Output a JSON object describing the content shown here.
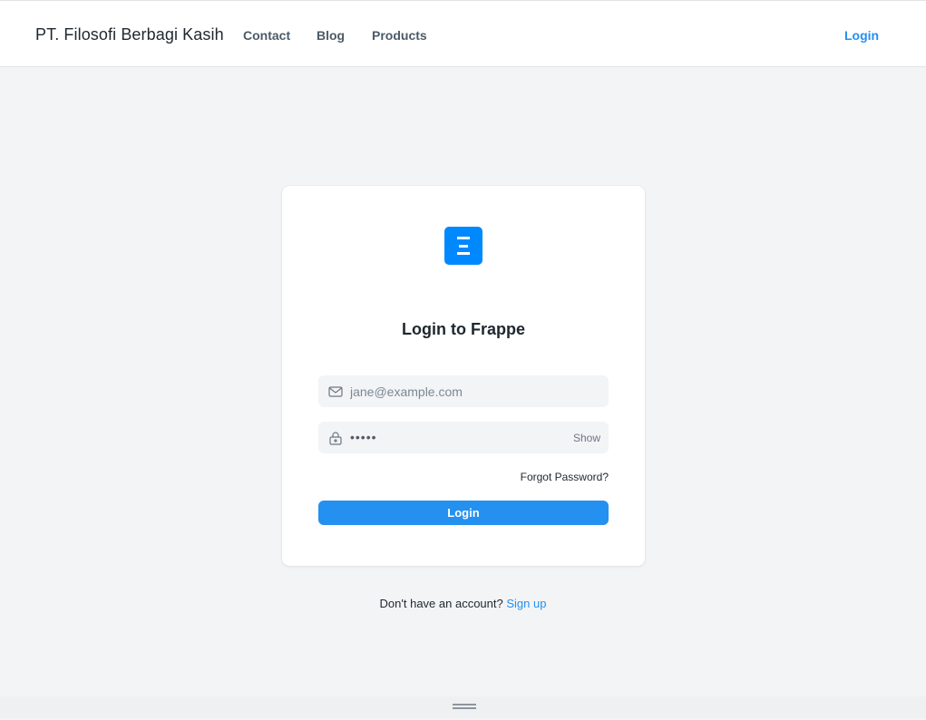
{
  "navbar": {
    "brand": "PT. Filosofi Berbagi Kasih",
    "links": [
      "Contact",
      "Blog",
      "Products"
    ],
    "login": "Login"
  },
  "card": {
    "logo_icon": "frappe-logo-icon",
    "title": "Login to Frappe",
    "email": {
      "icon": "mail-icon",
      "placeholder": "jane@example.com",
      "value": ""
    },
    "password": {
      "icon": "lock-icon",
      "value": "•••••",
      "show_label": "Show"
    },
    "forgot": "Forgot Password?",
    "submit": "Login"
  },
  "signup": {
    "prompt": "Don't have an account?",
    "link": "Sign up"
  },
  "colors": {
    "accent": "#2490ef",
    "logo": "#0089ff",
    "background": "#f3f4f6"
  }
}
